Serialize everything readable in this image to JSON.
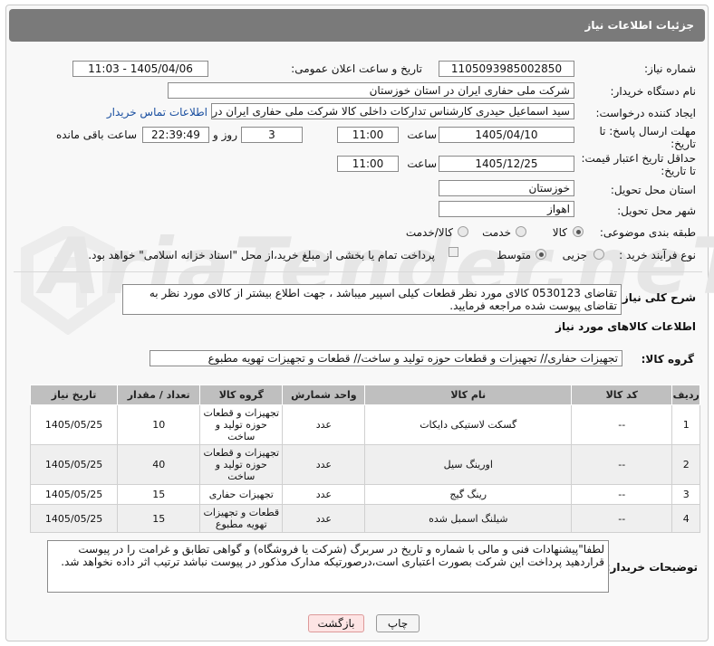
{
  "header": {
    "title": "جزئیات اطلاعات نیاز"
  },
  "form": {
    "need_number_label": "شماره نیاز:",
    "need_number": "1105093985002850",
    "announce_label": "تاریخ و ساعت اعلان عمومی:",
    "announce_value": "1405/04/06 - 11:03",
    "buyer_label": "نام دستگاه خریدار:",
    "buyer_value": "شرکت ملی حفاری ایران در استان خوزستان",
    "creator_label": "ایجاد کننده درخواست:",
    "creator_value": "سید اسماعیل حیدری کارشناس تدارکات داخلی کالا شرکت ملی حفاری ایران در",
    "contact_link": "اطلاعات تماس خریدار",
    "deadline_label_1": "مهلت ارسال پاسخ: تا",
    "deadline_label_2": "تاریخ:",
    "deadline_date": "1405/04/10",
    "time_word": "ساعت",
    "deadline_time": "11:00",
    "days_value": "3",
    "days_word": "روز و",
    "remain_time": "22:39:49",
    "remain_word": "ساعت باقی مانده",
    "min_label_1": "حداقل تاریخ اعتبار قیمت:",
    "min_label_2": "تا تاریخ:",
    "min_date": "1405/12/25",
    "min_time": "11:00",
    "province_label": "استان محل تحویل:",
    "province_value": "خوزستان",
    "city_label": "شهر محل تحویل:",
    "city_value": "اهواز",
    "category_label": "طبقه بندی موضوعی:",
    "cat_goods": "کالا",
    "cat_service": "خدمت",
    "cat_both": "کالا/خدمت",
    "process_label": "نوع فرآیند خرید :",
    "proc_partial": "جزیی",
    "proc_medium": "متوسط",
    "payment_note": "پرداخت تمام یا بخشی از مبلغ خرید،از محل \"اسناد خزانه اسلامی\" خواهد بود."
  },
  "desc": {
    "label": "شرح کلی نیاز:",
    "text": "تقاضای 0530123 کالای مورد نظر قطعات کیلی اسپیر میباشد ، جهت اطلاع بیشتر از کالای مورد نظر به تقاضای پیوست شده مراجعه فرمایید."
  },
  "items_section": {
    "title": "اطلاعات کالاهای مورد نیاز",
    "group_label": "گروه کالا:",
    "group_value": "تجهیزات حفاری// تجهیزات و قطعات حوزه تولید و ساخت//  قطعات و تجهیزات تهویه مطبوع"
  },
  "table": {
    "headers": [
      "ردیف",
      "کد کالا",
      "نام کالا",
      "واحد شمارش",
      "گروه کالا",
      "تعداد / مقدار",
      "تاریخ نیاز"
    ],
    "rows": [
      {
        "row": "1",
        "code": "--",
        "name": "گسکت لاستیکی دایکات",
        "unit": "عدد",
        "group": "تجهیزات و قطعات حوزه تولید و ساخت",
        "qty": "10",
        "date": "1405/05/25"
      },
      {
        "row": "2",
        "code": "--",
        "name": "اورینگ سیل",
        "unit": "عدد",
        "group": "تجهیزات و قطعات حوزه تولید و ساخت",
        "qty": "40",
        "date": "1405/05/25"
      },
      {
        "row": "3",
        "code": "--",
        "name": "رینگ گیج",
        "unit": "عدد",
        "group": "تجهیزات حفاری",
        "qty": "15",
        "date": "1405/05/25"
      },
      {
        "row": "4",
        "code": "--",
        "name": "شیلنگ اسمبل شده",
        "unit": "عدد",
        "group": "قطعات و تجهیزات تهویه مطبوع",
        "qty": "15",
        "date": "1405/05/25"
      }
    ]
  },
  "notes": {
    "label": "توضیحات خریدار:",
    "text": "لطفا\"پیشنهادات فنی و مالی با شماره و تاریخ در سربرگ (شرکت یا فروشگاه) و گواهی تطابق و غرامت را در پیوست قراردهید پرداخت این شرکت بصورت اعتباری است،درصورتیکه مدارک مذکور در پیوست نباشد ترتیب اثر داده نخواهد شد."
  },
  "buttons": {
    "print": "چاپ",
    "back": "بازگشت"
  },
  "watermark": {
    "text": "AriaTender.neT"
  }
}
